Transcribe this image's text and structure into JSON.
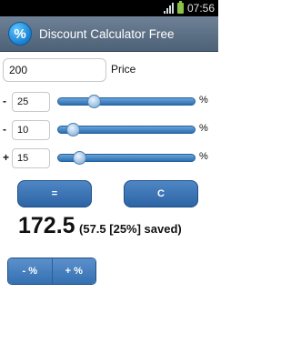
{
  "status_bar": {
    "time": "07:56"
  },
  "app_bar": {
    "icon_glyph": "%",
    "title": "Discount Calculator Free"
  },
  "price": {
    "value": "200",
    "label": "Price"
  },
  "rows": [
    {
      "sign": "-",
      "value": "25",
      "slider_percent": 25,
      "unit": "%"
    },
    {
      "sign": "-",
      "value": "10",
      "slider_percent": 10,
      "unit": "%"
    },
    {
      "sign": "+",
      "value": "15",
      "slider_percent": 15,
      "unit": "%"
    }
  ],
  "buttons": {
    "equals": "=",
    "clear": "C"
  },
  "result": {
    "main": "172.5",
    "detail": "(57.5 [25%] saved)"
  },
  "toggle": {
    "minus": "- %",
    "plus": "+ %"
  },
  "colors": {
    "app_bar": "#5a6e84",
    "accent": "#3a72b4",
    "battery": "#8bc34a"
  }
}
